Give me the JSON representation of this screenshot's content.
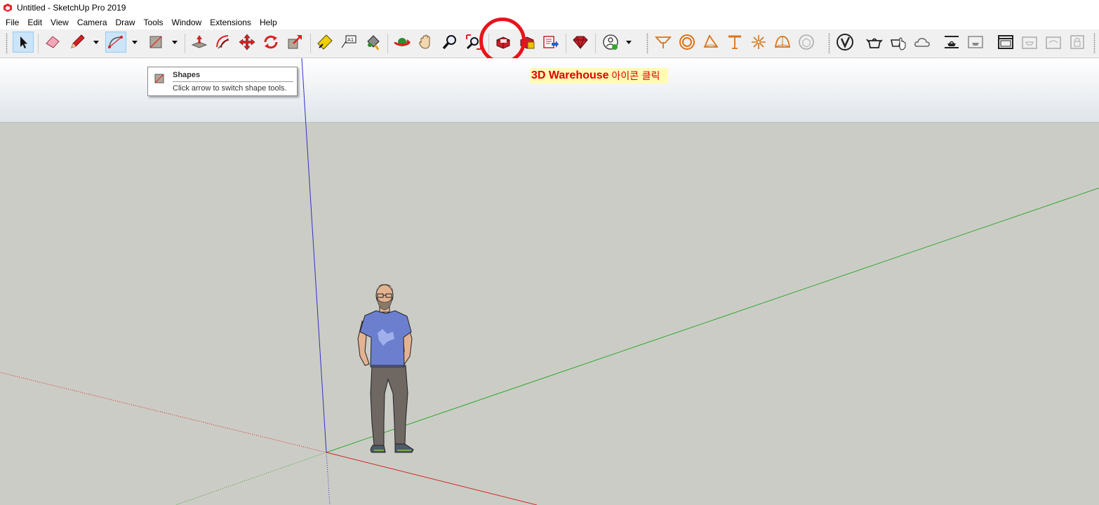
{
  "window": {
    "title": "Untitled - SketchUp Pro 2019"
  },
  "menu": [
    "File",
    "Edit",
    "View",
    "Camera",
    "Draw",
    "Tools",
    "Window",
    "Extensions",
    "Help"
  ],
  "tooltip": {
    "title": "Shapes",
    "description": "Click arrow to switch shape tools."
  },
  "annotation": {
    "strong": "3D Warehouse",
    "rest": "아이콘 클릭"
  },
  "colors": {
    "highlight": "#e8131b",
    "annotation_text": "#e00000",
    "annotation_bg": "#fffbb3",
    "ground": "#ccccc6",
    "axis_red": "#d92020",
    "axis_green": "#2eaa2e",
    "axis_blue": "#3030cc"
  },
  "toolbar": {
    "tools": [
      "select-tool-icon",
      "eraser-tool-icon",
      "pencil-line-tool-icon",
      "arc-tool-icon",
      "shapes-rectangle-tool-icon",
      "push-pull-tool-icon",
      "offset-tool-icon",
      "move-tool-icon",
      "rotate-tool-icon",
      "scale-tool-icon",
      "tape-measure-tool-icon",
      "text-tool-icon",
      "paint-bucket-tool-icon",
      "orbit-tool-icon",
      "pan-tool-icon",
      "zoom-tool-icon",
      "zoom-extents-tool-icon",
      "3d-warehouse-icon",
      "extension-warehouse-icon",
      "send-to-layout-icon",
      "extension-manager-icon",
      "account-icon",
      "sandbox-from-contours-icon",
      "sandbox-from-scratch-icon",
      "sandbox-smoove-icon",
      "sandbox-stamp-icon",
      "sandbox-drape-icon",
      "sandbox-add-detail-icon",
      "sandbox-flip-edge-icon",
      "vray-logo-icon",
      "vray-render-icon",
      "vray-interactive-render-icon",
      "vray-cloud-render-icon",
      "vray-frame-buffer-icon",
      "vray-batch-render-icon",
      "vray-window-icon",
      "vray-material-editor-icon",
      "vray-lights-icon",
      "vray-lock-icon"
    ]
  }
}
